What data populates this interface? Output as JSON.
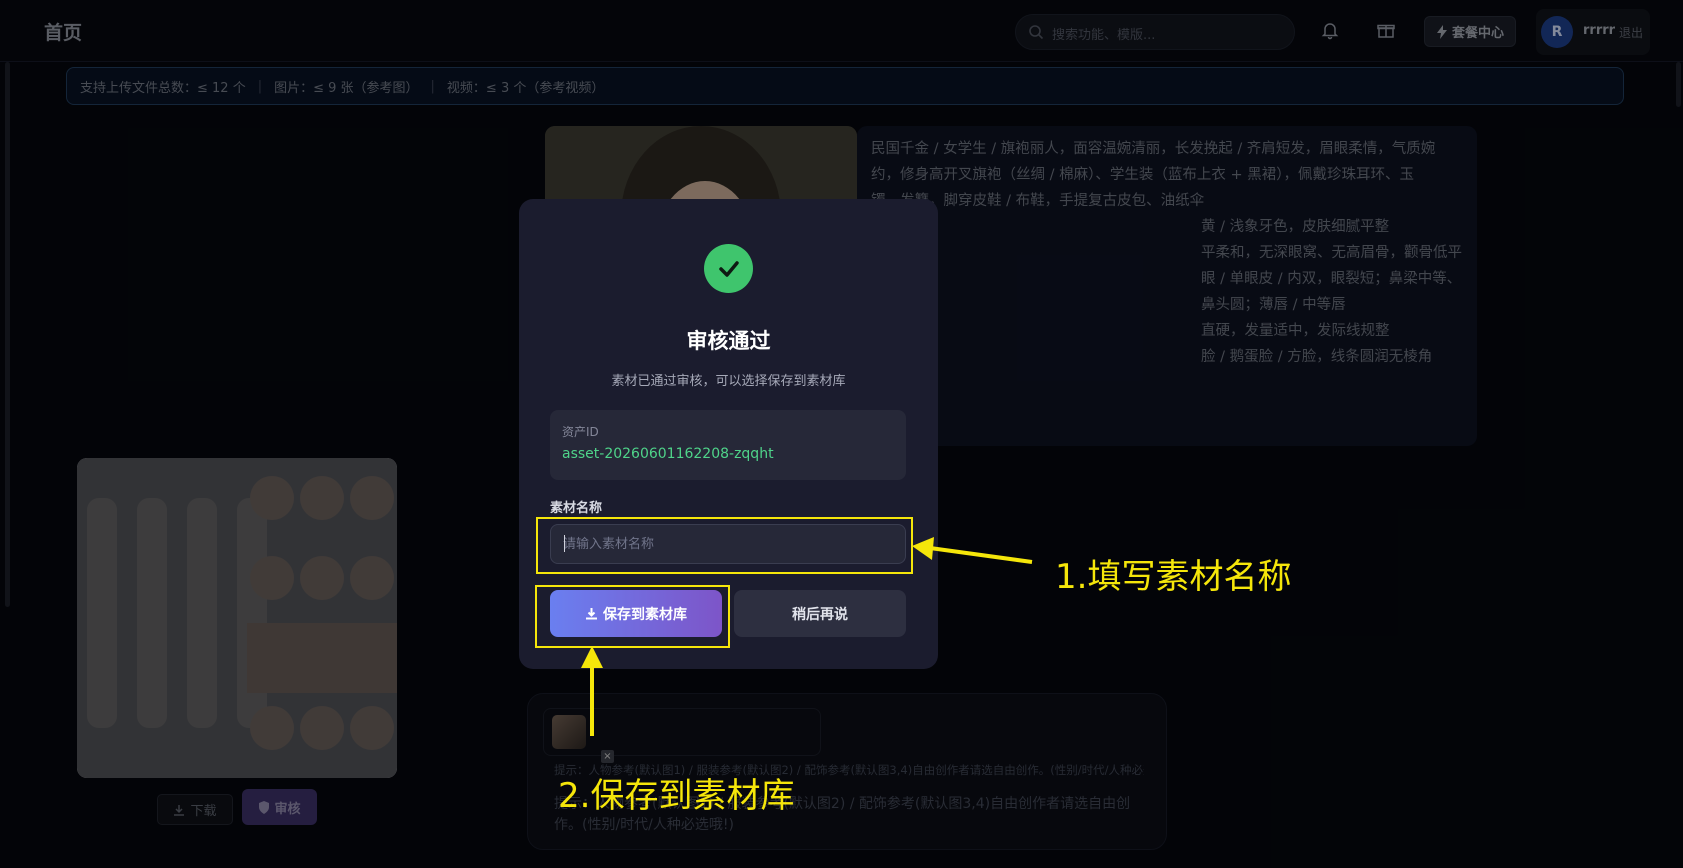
{
  "header": {
    "title": "首页",
    "search_placeholder": "搜索功能、模版...",
    "plan_label": "套餐中心",
    "avatar_initial": "R",
    "username": "rrrrr",
    "logout_label": "退出"
  },
  "notice": {
    "total": "支持上传文件总数：≤ 12 个",
    "images": "图片：≤ 9 张（参考图）",
    "videos": "视频：≤ 3 个（参考视频）"
  },
  "description": {
    "lines": [
      "民国千金 / 女学生 / 旗袍丽人，面容温婉清丽，长发挽起 / 齐肩短发，眉眼柔情，气质婉",
      "约，修身高开叉旗袍（丝绸 / 棉麻）、学生装（蓝布上衣 + 黑裙），佩戴珍珠耳环、玉",
      "镯、发簪，脚穿皮鞋 / 布鞋，手提复古皮包、油纸伞",
      "黄 / 浅象牙色，皮肤细腻平整",
      "平柔和，无深眼窝、无高眉骨，颧骨低平",
      "眼 / 单眼皮 / 内双，眼裂短；鼻梁中等、鼻头圆；薄唇 / 中等唇",
      "直硬，发量适中，发际线规整",
      "脸 / 鹅蛋脸 / 方脸，线条圆润无棱角"
    ]
  },
  "gallery": {
    "download_label": "下载",
    "review_label": "审核"
  },
  "compose": {
    "hint_small": "提示：人物参考(默认图1) / 服装参考(默认图2) / 配饰参考(默认图3,4)自由创作者请选自由创作。(性别/时代/人种必选哦!)",
    "hint_main": "提示：人物参考(默认图1) / 服装参考(默认图2) / 配饰参考(默认图3,4)自由创作者请选自由创作。(性别/时代/人种必选哦!)",
    "remove_glyph": "×"
  },
  "modal": {
    "title": "审核通过",
    "subtitle": "素材已通过审核，可以选择保存到素材库",
    "asset_label": "资产ID",
    "asset_id": "asset-20260601162208-zqqht",
    "name_label": "素材名称",
    "name_placeholder": "请输入素材名称",
    "name_value": "",
    "save_label": "保存到素材库",
    "later_label": "稍后再说"
  },
  "annotations": {
    "step1": "1.填写素材名称",
    "step2": "2.保存到素材库",
    "color": "#f5e60a"
  }
}
